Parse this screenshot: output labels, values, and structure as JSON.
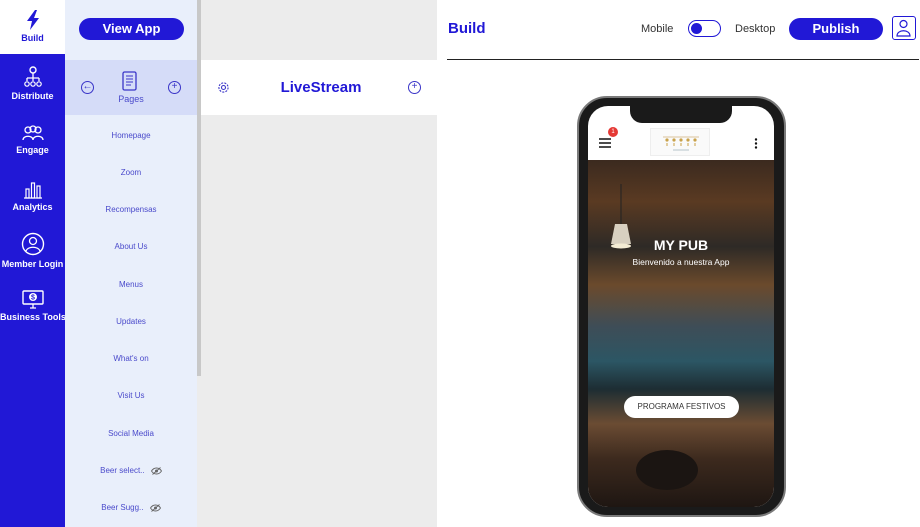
{
  "nav": {
    "items": [
      {
        "label": "Build",
        "icon": "bolt-icon",
        "active": true
      },
      {
        "label": "Distribute",
        "icon": "network-icon",
        "active": false
      },
      {
        "label": "Engage",
        "icon": "people-icon",
        "active": false
      },
      {
        "label": "Analytics",
        "icon": "bar-chart-icon",
        "active": false
      },
      {
        "label": "Member Login",
        "icon": "user-circle-icon",
        "active": false
      },
      {
        "label": "Business Tools",
        "icon": "monitor-dollar-icon",
        "active": false
      }
    ]
  },
  "pages_panel": {
    "view_app_label": "View App",
    "header_label": "Pages",
    "items": [
      {
        "label": "Homepage",
        "hidden": false
      },
      {
        "label": "Zoom",
        "hidden": false
      },
      {
        "label": "Recompensas",
        "hidden": false
      },
      {
        "label": "About Us",
        "hidden": false
      },
      {
        "label": "Menus",
        "hidden": false
      },
      {
        "label": "Updates",
        "hidden": false
      },
      {
        "label": "What's on",
        "hidden": false
      },
      {
        "label": "Visit Us",
        "hidden": false
      },
      {
        "label": "Social Media",
        "hidden": false
      },
      {
        "label": "Beer select..",
        "hidden": true
      },
      {
        "label": "Beer Sugg..",
        "hidden": true
      }
    ]
  },
  "detail_panel": {
    "title": "LiveStream"
  },
  "header": {
    "title": "Build",
    "toggle_left": "Mobile",
    "toggle_right": "Desktop",
    "publish_label": "Publish"
  },
  "preview": {
    "badge_count": "1",
    "hero_title": "MY PUB",
    "hero_subtitle": "Bienvenido a nuestra App",
    "cta_label": "PROGRAMA FESTIVOS"
  },
  "colors": {
    "brand": "#2118d6",
    "panel_bg": "#e9effb",
    "panel_header_bg": "#d5dcf8",
    "badge": "#e53935"
  }
}
